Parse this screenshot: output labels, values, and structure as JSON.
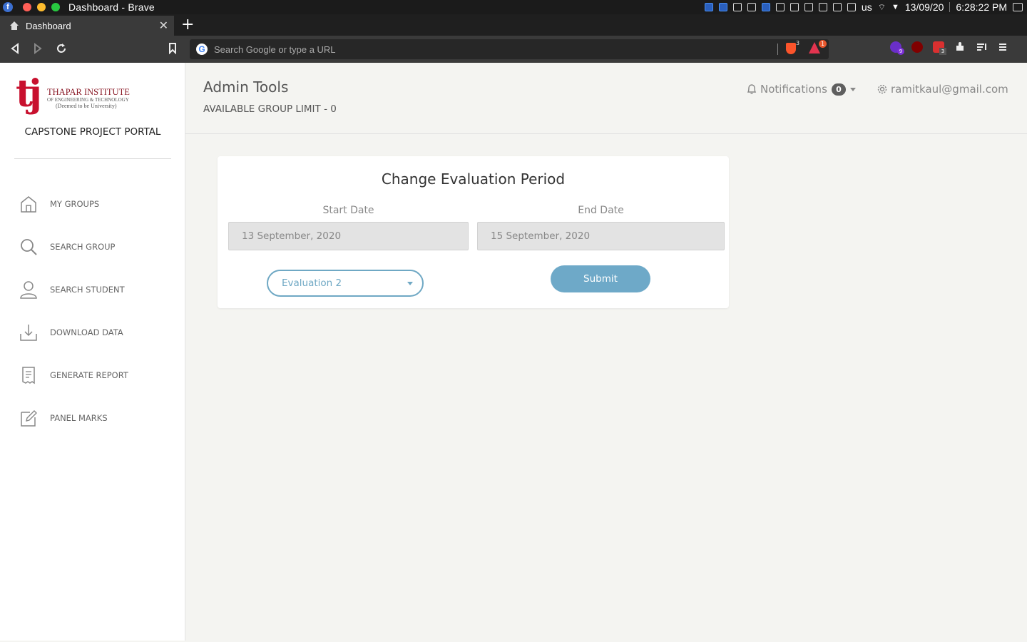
{
  "os": {
    "window_title": "Dashboard - Brave",
    "keyboard_layout": "us",
    "date": "13/09/20",
    "time": "6:28:22 PM"
  },
  "browser": {
    "tab_title": "Dashboard",
    "tab_close": "✕",
    "new_tab": "+",
    "url_placeholder": "Search Google or type a URL",
    "google_glyph": "G",
    "brave_shield_count": "3",
    "rewards_count": "1",
    "ext_badges": [
      "9",
      "3"
    ]
  },
  "sidebar": {
    "logo_glyph": "tj",
    "logo_name": "THAPAR INSTITUTE",
    "logo_sub": "OF ENGINEERING & TECHNOLOGY",
    "logo_sub2": "(Deemed to be University)",
    "portal_title": "CAPSTONE PROJECT PORTAL",
    "items": [
      {
        "label": "MY GROUPS",
        "icon": "home-icon"
      },
      {
        "label": "SEARCH GROUP",
        "icon": "search-icon"
      },
      {
        "label": "SEARCH STUDENT",
        "icon": "user-icon"
      },
      {
        "label": "DOWNLOAD DATA",
        "icon": "download-icon"
      },
      {
        "label": "GENERATE REPORT",
        "icon": "report-icon"
      },
      {
        "label": "PANEL MARKS",
        "icon": "edit-icon"
      }
    ]
  },
  "header": {
    "title": "Admin Tools",
    "group_limit": "AVAILABLE GROUP LIMIT - 0",
    "notifications_label": "Notifications",
    "notifications_count": "0",
    "user_email": "ramitkaul@gmail.com"
  },
  "card": {
    "title": "Change Evaluation Period",
    "start_label": "Start Date",
    "start_value": "13 September, 2020",
    "end_label": "End Date",
    "end_value": "15 September, 2020",
    "evaluation_selected": "Evaluation 2",
    "submit_label": "Submit"
  },
  "colors": {
    "accent": "#6ea9c8",
    "brand_red": "#c8102e",
    "sidebar_bg": "#ffffff",
    "page_bg": "#f4f4f1"
  }
}
